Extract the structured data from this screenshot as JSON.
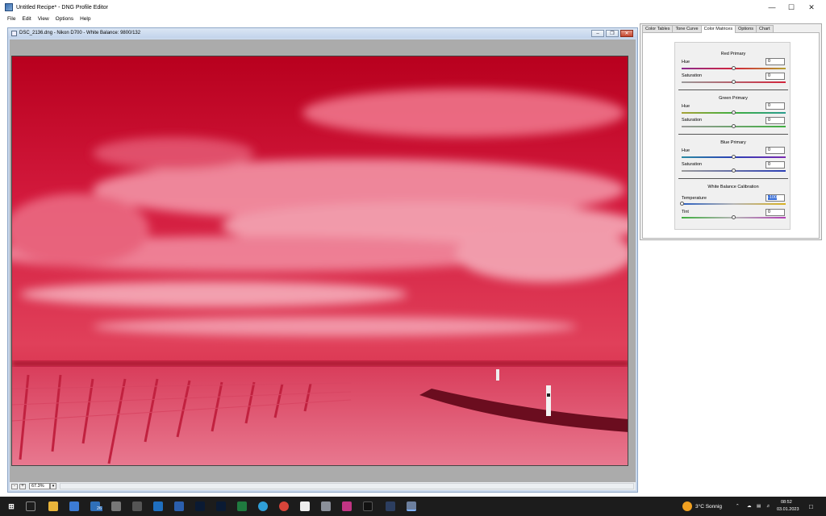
{
  "window": {
    "title": "Untitled Recipe* - DNG Profile Editor"
  },
  "menu": [
    "File",
    "Edit",
    "View",
    "Options",
    "Help"
  ],
  "image_window": {
    "title": "DSC_2136.dng  - Nikon D700 - White Balance: 9800/132",
    "zoom": "67.3%"
  },
  "panel": {
    "tabs": [
      "Color Tables",
      "Tone Curve",
      "Color Matrices",
      "Options",
      "Chart"
    ],
    "active_tab": "Color Matrices",
    "red": {
      "title": "Red Primary",
      "hue_label": "Hue",
      "hue": "0",
      "sat_label": "Saturation",
      "sat": "0"
    },
    "green": {
      "title": "Green Primary",
      "hue_label": "Hue",
      "hue": "0",
      "sat_label": "Saturation",
      "sat": "0"
    },
    "blue": {
      "title": "Blue Primary",
      "hue_label": "Hue",
      "hue": "0",
      "sat_label": "Saturation",
      "sat": "0"
    },
    "wb": {
      "title": "White Balance Calibration",
      "temp_label": "Temperature",
      "temp": "-100",
      "tint_label": "Tint",
      "tint": "0"
    }
  },
  "taskbar": {
    "weather": "3°C  Sonnig",
    "time": "08:52",
    "date": "03.01.2023",
    "badge": "26",
    "icons": [
      "windows-start",
      "task-view",
      "file-explorer",
      "store",
      "mail",
      "settings",
      "calculator",
      "outlook",
      "word",
      "lightroom-classic",
      "photoshop",
      "excel",
      "edge",
      "chrome",
      "notepad",
      "app",
      "instagram",
      "dark-app",
      "app-c",
      "dng-profile-editor"
    ]
  },
  "colors": {
    "accent": "#3a6fd8",
    "photo_red": "#d5203f"
  }
}
